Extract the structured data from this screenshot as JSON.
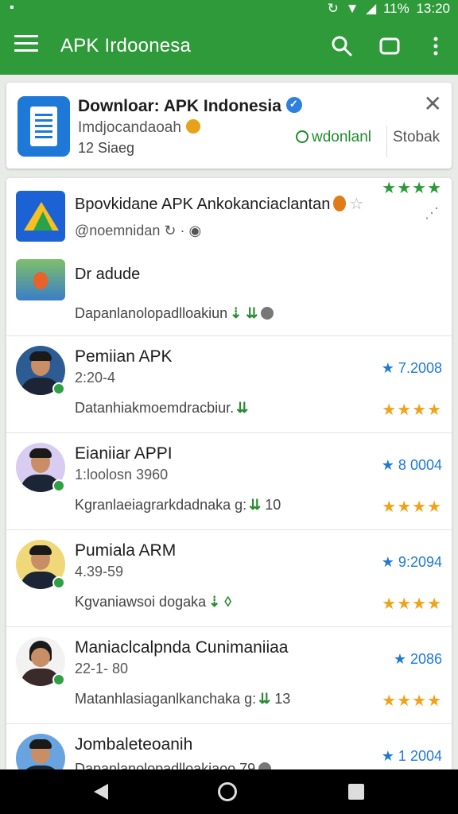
{
  "status_bar": {
    "battery": "11%",
    "time": "13:20"
  },
  "app_bar": {
    "title": "APK Irdoonesa"
  },
  "promo": {
    "title": "Downloar: APK Indonesia",
    "subtitle": "Imdjocandaoah",
    "size": "12 Siaeg",
    "download_label": "wdonlanl",
    "stop_label": "Stobak",
    "close_label": "✕"
  },
  "featured": {
    "name": "Bpovkidane APK Ankokanciaclantan",
    "developer": "@noemnidan",
    "subtitle": "Dr adude",
    "description": "Dapanlanolopadlloakiun",
    "stars": "★★★★"
  },
  "apps": [
    {
      "name": "Pemiian APK",
      "version": "2:20-4",
      "rating": "★ 7.2008",
      "description": "Datanhiakmoemdracbiur.",
      "stars": "★★★★"
    },
    {
      "name": "Eianiiar APPI",
      "version": "1:loolosn 3960",
      "rating": "★ 8 0004",
      "description": "Kgranlaeiagrarkdadnaka g:",
      "tail": "10",
      "stars": "★★★★"
    },
    {
      "name": "Pumiala ARM",
      "version": "4.39-59",
      "rating": "★ 9:2094",
      "description": "Kgvaniawsoi dogaka",
      "stars": "★★★★"
    },
    {
      "name": "Maniaclcalpnda Cunimaniiaa",
      "version": "22-1- 80",
      "rating": "★ 2086",
      "description": "Matanhlasiaganlkanchaka g:",
      "tail": "13",
      "stars": "★★★★"
    },
    {
      "name": "Jombaleteoanih",
      "version": "",
      "rating": "★ 1 2004",
      "description": "Dapanlanolopadlloakiaoo 79",
      "stars": ""
    }
  ],
  "colors": {
    "primary": "#2f9a3a",
    "accent_blue": "#1e78d8",
    "star_gold": "#f0a318",
    "star_green": "#2a9a3a"
  }
}
